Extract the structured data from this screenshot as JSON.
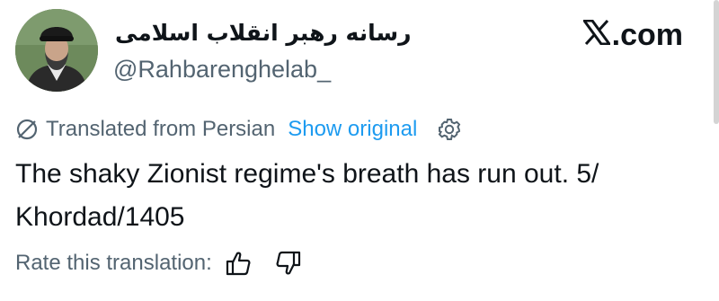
{
  "author": {
    "display_name": "رسانه رهبر انقلاب اسلامی",
    "handle": "@Rahbarenghelab_"
  },
  "brand": {
    "icon": "x-logo-icon",
    "text": ".com"
  },
  "translation": {
    "icon": "translate-icon",
    "label": "Translated from Persian",
    "show_original": "Show original",
    "settings_icon": "gear-icon"
  },
  "tweet": {
    "text": "The shaky Zionist regime's breath has run out. 5/ Khordad/1405"
  },
  "rating": {
    "label": "Rate this translation:",
    "up_icon": "thumbs-up-icon",
    "down_icon": "thumbs-down-icon"
  },
  "colors": {
    "text": "#0f1419",
    "secondary": "#536471",
    "link": "#1d9bf0"
  }
}
